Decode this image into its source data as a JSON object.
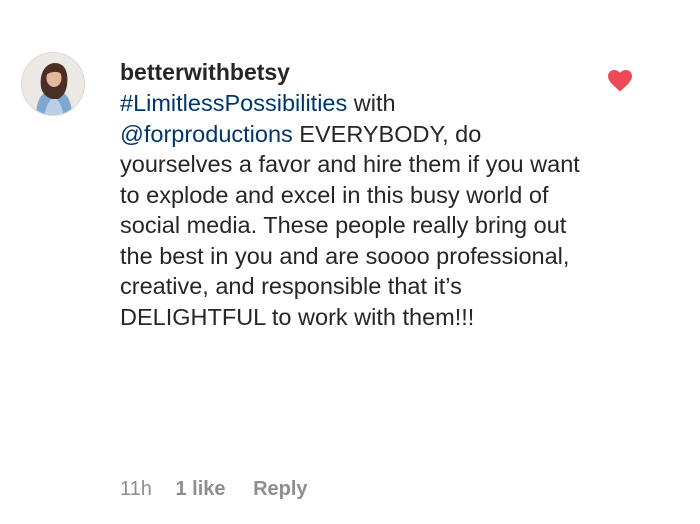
{
  "comment": {
    "username": "betterwithbetsy",
    "hashtag": "#LimitlessPossibilities",
    "after_hashtag": " with",
    "mention": "@forproductions",
    "text": " EVERYBODY, do yourselves a favor and hire them if you want to explode and excel in this busy world of social media. These people really bring out the best in you and are soooo professional, creative, and responsible that it’s DELIGHTFUL to work with them!!!",
    "time": "11h",
    "likes": "1 like",
    "reply": "Reply",
    "liked": true,
    "heart_color": "#ed4956",
    "link_color": "#00376b"
  }
}
